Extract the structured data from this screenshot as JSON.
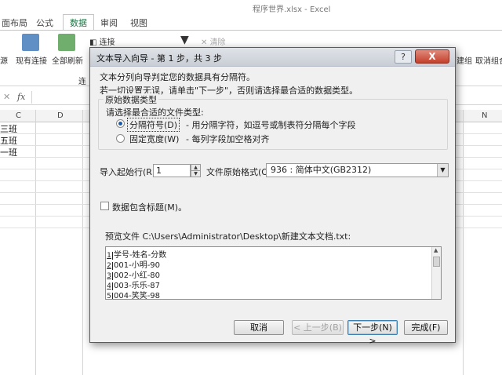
{
  "excel": {
    "window_title": "程序世界.xlsx - Excel",
    "tabs": [
      {
        "label": "面布局"
      },
      {
        "label": "公式"
      },
      {
        "label": "数据"
      },
      {
        "label": "审阅"
      },
      {
        "label": "视图"
      }
    ],
    "ribbon": {
      "source_label": "源",
      "existing_conn_label": "现有连接",
      "refresh_all_label": "全部刷新",
      "connections_label": "连接",
      "clear_label": "清除",
      "connect_group_label": "连",
      "ungroup_label": "取消组合",
      "group_label": "建组"
    },
    "fx_label": "fx",
    "columns": [
      "C",
      "D",
      "N"
    ],
    "cells": [
      "三班",
      "五班",
      "一班"
    ]
  },
  "dialog": {
    "title": "文本导入向导 - 第 1 步，共 3 步",
    "help_label": "?",
    "close_label": "X",
    "intro_line1": "文本分列向导判定您的数据具有分隔符。",
    "intro_line2": "若一切设置无误，请单击\"下一步\"，否则请选择最合适的数据类型。",
    "group_title": "原始数据类型",
    "group_prompt": "请选择最合适的文件类型:",
    "radio_delimited_label": "分隔符号(D)",
    "radio_delimited_desc": "- 用分隔字符，如逗号或制表符分隔每个字段",
    "radio_fixed_label": "固定宽度(W)",
    "radio_fixed_desc": "- 每列字段加空格对齐",
    "start_row_label": "导入起始行(R):",
    "start_row_value": "1",
    "file_origin_label": "文件原始格式(O):",
    "file_origin_value": "936 : 简体中文(GB2312)",
    "headers_checkbox_label": "数据包含标题(M)。",
    "preview_label": "预览文件 C:\\Users\\Administrator\\Desktop\\新建文本文档.txt:",
    "preview_rows": [
      {
        "num": "1",
        "line": "学号-姓名-分数"
      },
      {
        "num": "2",
        "line": "001-小明-90"
      },
      {
        "num": "3",
        "line": "002-小红-80"
      },
      {
        "num": "4",
        "line": "003-乐乐-87"
      },
      {
        "num": "5",
        "line": "004-笑笑-98"
      }
    ],
    "buttons": {
      "cancel": "取消",
      "back": "< 上一步(B)",
      "next": "下一步(N) >",
      "finish": "完成(F)"
    }
  }
}
